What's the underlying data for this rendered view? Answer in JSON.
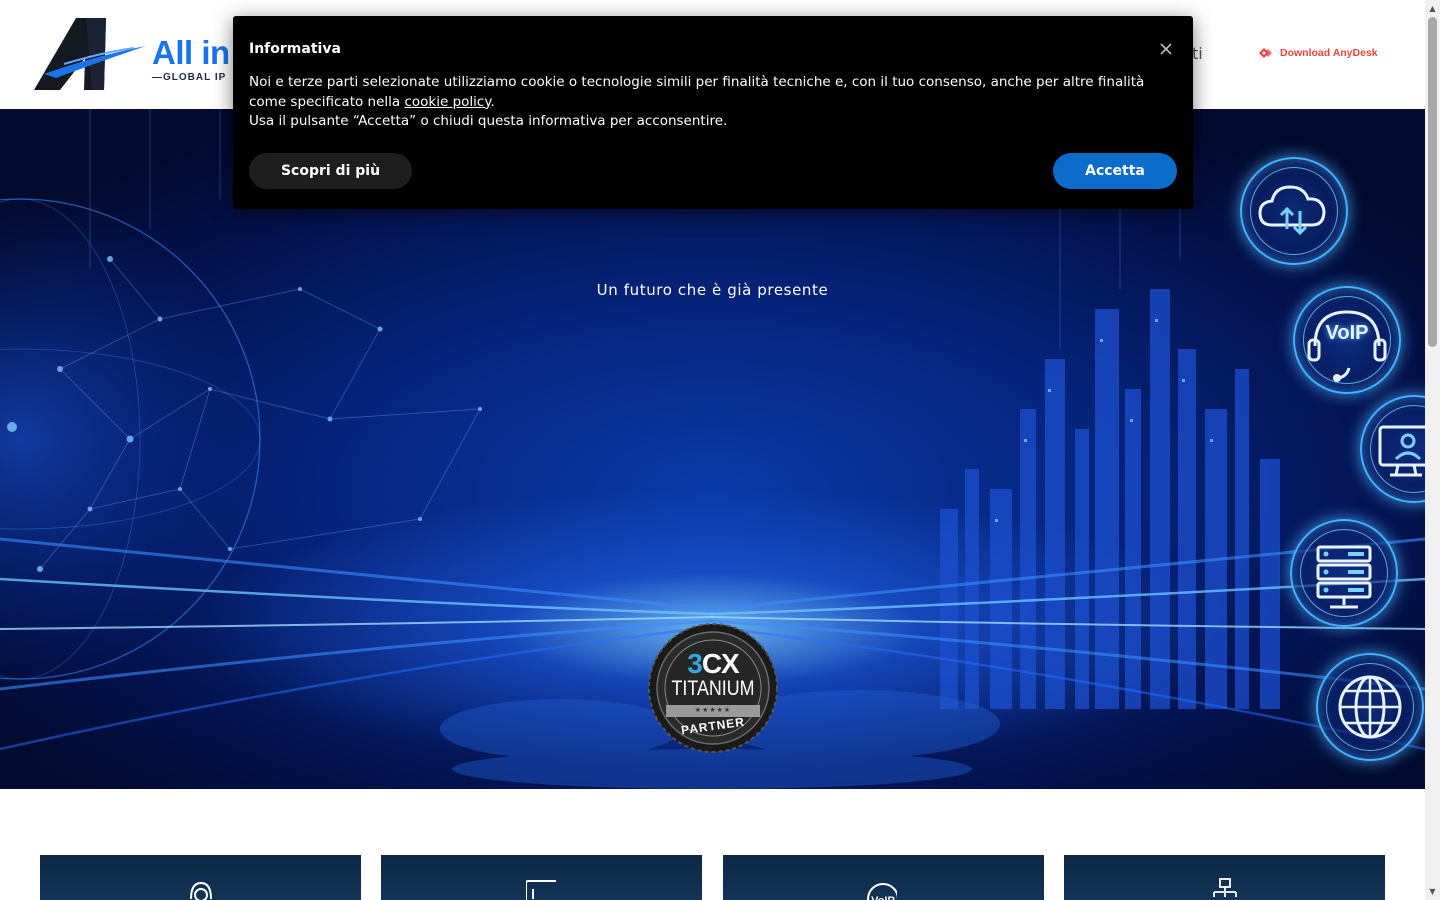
{
  "header": {
    "logo_text": "All in",
    "logo_subtext": "GLOBAL IP",
    "nav_partial_label": "ti",
    "anydesk_label": "Download AnyDesk",
    "anydesk_color": "#ef443b"
  },
  "hero": {
    "tagline": "Un futuro che è già presente",
    "badge": {
      "brand_prefix": "3",
      "brand_suffix": "CX",
      "tier": "TITANIUM",
      "stars": "★★★★★",
      "label": "PARTNER"
    },
    "service_icons": [
      "cloud-upload-download-icon",
      "voip-headset-icon",
      "remote-desktop-user-icon",
      "server-rack-icon",
      "globe-icon"
    ],
    "voip_label": "VoIP"
  },
  "cookie_banner": {
    "title": "Informativa",
    "text_part1": "Noi e terze parti selezionate utilizziamo cookie o tecnologie simili per finalità tecniche e, con il tuo consenso, anche per altre finalità come specificato nella ",
    "link_text": "cookie policy",
    "text_part2": ".",
    "text_line3": "Usa il pulsante “Accetta” o chiudi questa informativa per acconsentire.",
    "learn_more_label": "Scopri di più",
    "accept_label": "Accetta",
    "accept_color": "#0b6cc9"
  },
  "cards": [
    {
      "icon": "headset-support-icon"
    },
    {
      "icon": "tablet-device-icon"
    },
    {
      "icon": "voip-phone-icon"
    },
    {
      "icon": "network-topology-icon"
    }
  ]
}
